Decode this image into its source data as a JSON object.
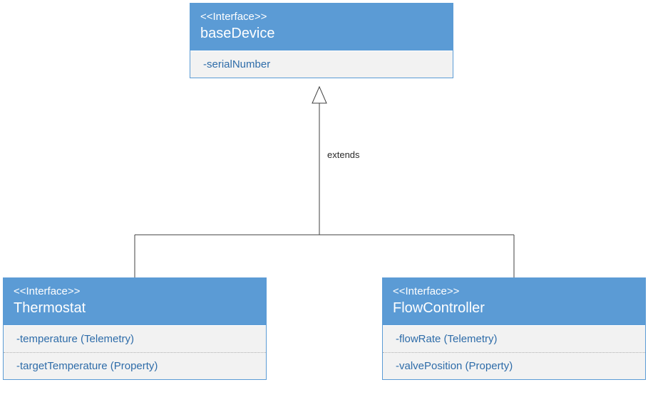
{
  "diagram": {
    "relationship_label": "extends",
    "base": {
      "stereotype": "<<Interface>>",
      "name": "baseDevice",
      "members": [
        "-serialNumber"
      ]
    },
    "left": {
      "stereotype": "<<Interface>>",
      "name": "Thermostat",
      "members": [
        "-temperature (Telemetry)",
        "-targetTemperature (Property)"
      ]
    },
    "right": {
      "stereotype": "<<Interface>>",
      "name": "FlowController",
      "members": [
        "-flowRate (Telemetry)",
        "-valvePosition (Property)"
      ]
    }
  }
}
